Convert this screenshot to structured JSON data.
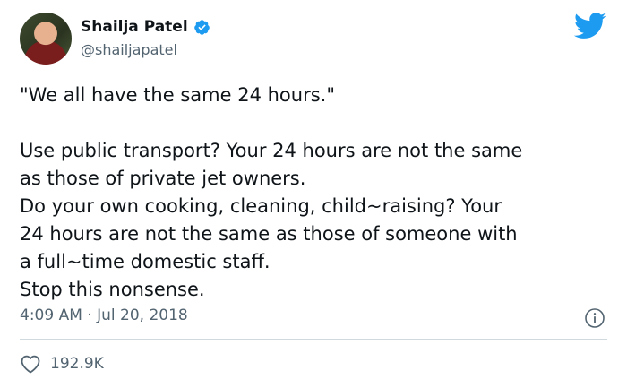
{
  "author": {
    "name": "Shailja Patel",
    "handle": "@shailjapatel",
    "verified": true
  },
  "tweet": {
    "line1": "\"We all have the same 24 hours.\"",
    "line2": "Use public transport? Your 24 hours are not the same\nas those of private jet owners.",
    "line3": "Do your own cooking, cleaning, child~raising? Your\n24 hours are not the same as those of someone with\na full~time domestic staff.",
    "line4": "Stop this nonsense."
  },
  "meta": {
    "time": "4:09 AM",
    "separator": "·",
    "date": "Jul 20, 2018"
  },
  "likes": {
    "count": "192.9K"
  },
  "colors": {
    "twitter_blue": "#1d9bf0",
    "text": "#0f1419",
    "muted": "#536471"
  },
  "icons": {
    "brand": "twitter-bird-icon",
    "verified": "verified-badge-icon",
    "info": "info-icon",
    "like": "heart-icon"
  }
}
